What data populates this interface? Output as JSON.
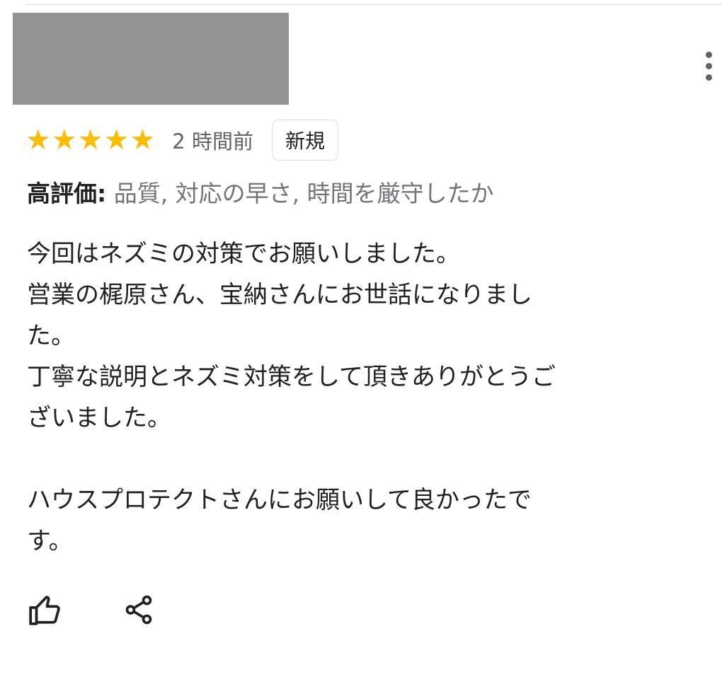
{
  "review": {
    "rating": 5,
    "max_rating": 5,
    "stars": [
      "★",
      "★",
      "★",
      "★",
      "★"
    ],
    "timestamp": "2 時間前",
    "badge": "新規",
    "highlights_label": "高評価:",
    "highlights_values": "品質, 対応の早さ, 時間を厳守したか",
    "body_lines": [
      "今回はネズミの対策でお願いしました。",
      "営業の梶原さん、宝納さんにお世話になりまし\nた。",
      "丁寧な説明とネズミ対策をして頂きありがとうご\nざいました。",
      "",
      "ハウスプロテクトさんにお願いして良かったで\nす。"
    ]
  },
  "icons": {
    "more": "more-vert-icon",
    "like": "thumb-up-icon",
    "share": "share-icon"
  },
  "colors": {
    "star": "#fbbc04",
    "text_primary": "#202124",
    "text_secondary": "#5f6368",
    "highlight_values": "#70757a",
    "avatar_placeholder": "#939393"
  }
}
